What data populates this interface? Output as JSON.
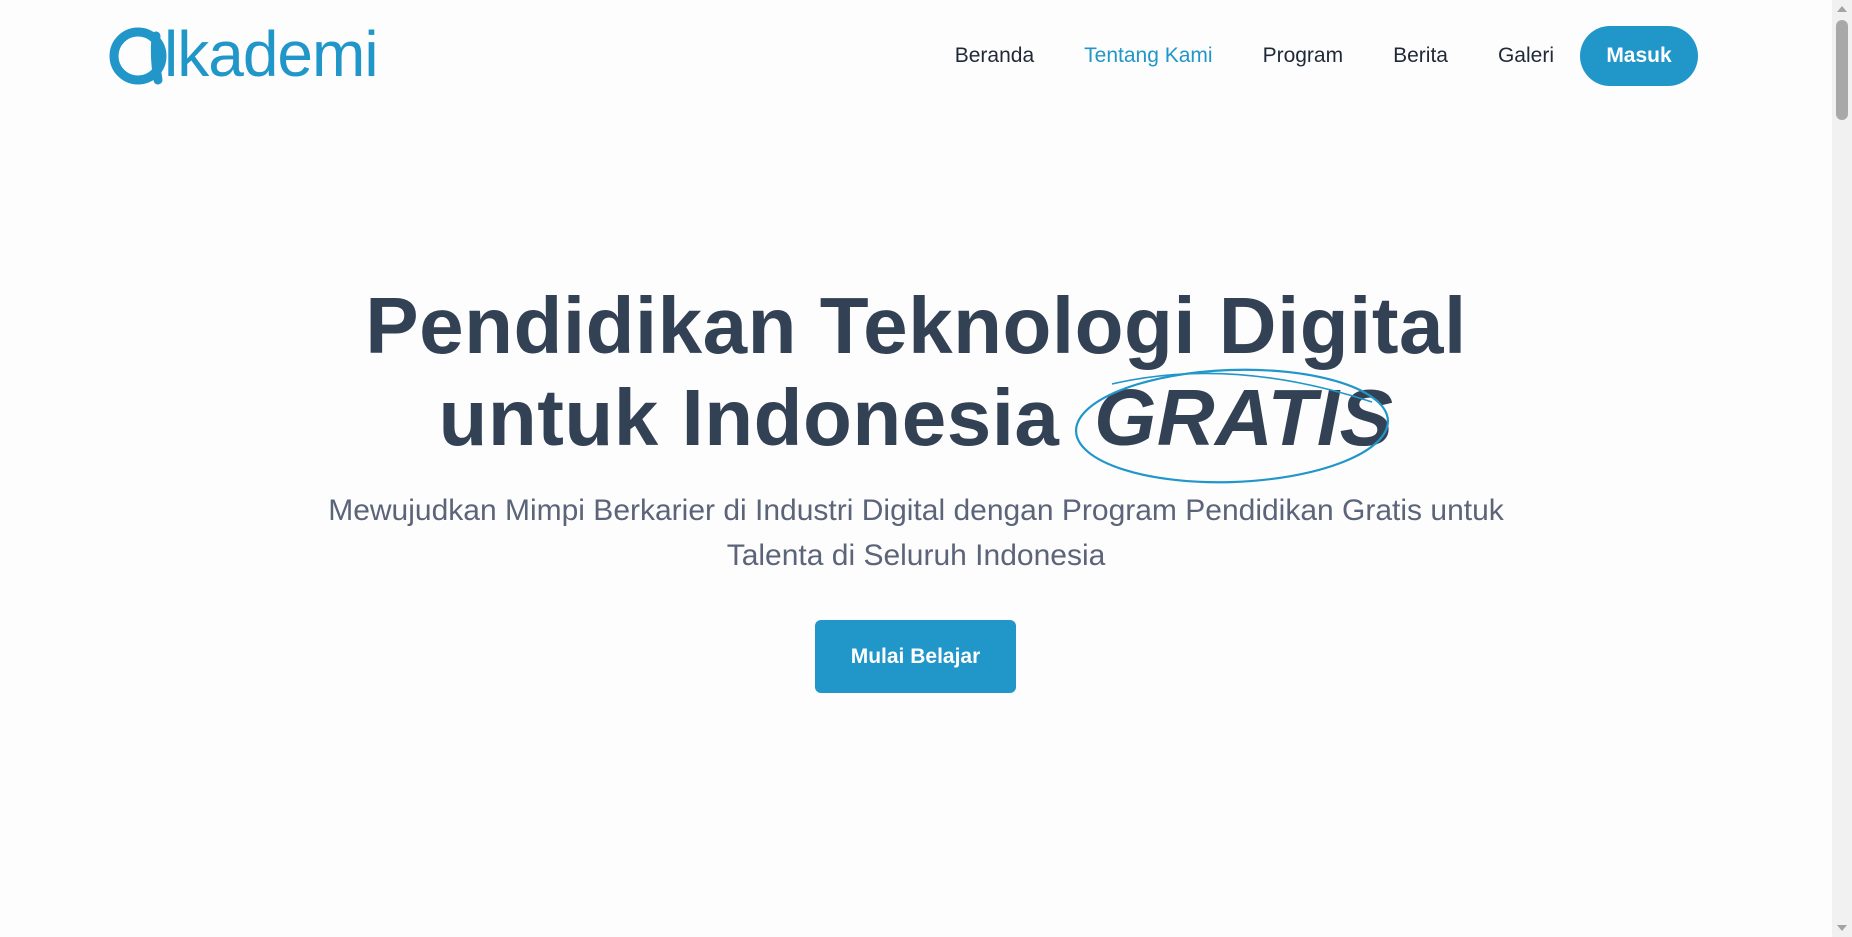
{
  "brand": {
    "logo_text": "lkadem i",
    "logo_mark_icon": "alpha-icon",
    "color": "#2196c9"
  },
  "nav": {
    "items": [
      {
        "label": "Beranda",
        "active": false
      },
      {
        "label": "Tentang Kami",
        "active": true
      },
      {
        "label": "Program",
        "active": false
      },
      {
        "label": "Berita",
        "active": false
      },
      {
        "label": "Galeri",
        "active": false
      }
    ],
    "login_label": "Masuk"
  },
  "hero": {
    "title_line1": "Pendidikan Teknologi Digital",
    "title_line2_prefix": "untuk Indonesia",
    "title_highlight": "GRATIS",
    "subtitle": "Mewujudkan Mimpi Berkarier di Industri Digital dengan Program Pendidikan Gratis untuk Talenta di Seluruh Indonesia",
    "cta_label": "Mulai Belajar"
  },
  "colors": {
    "accent": "#2196c9",
    "heading": "#334155",
    "body_text": "#5b6479",
    "nav_text": "#1f2937"
  }
}
